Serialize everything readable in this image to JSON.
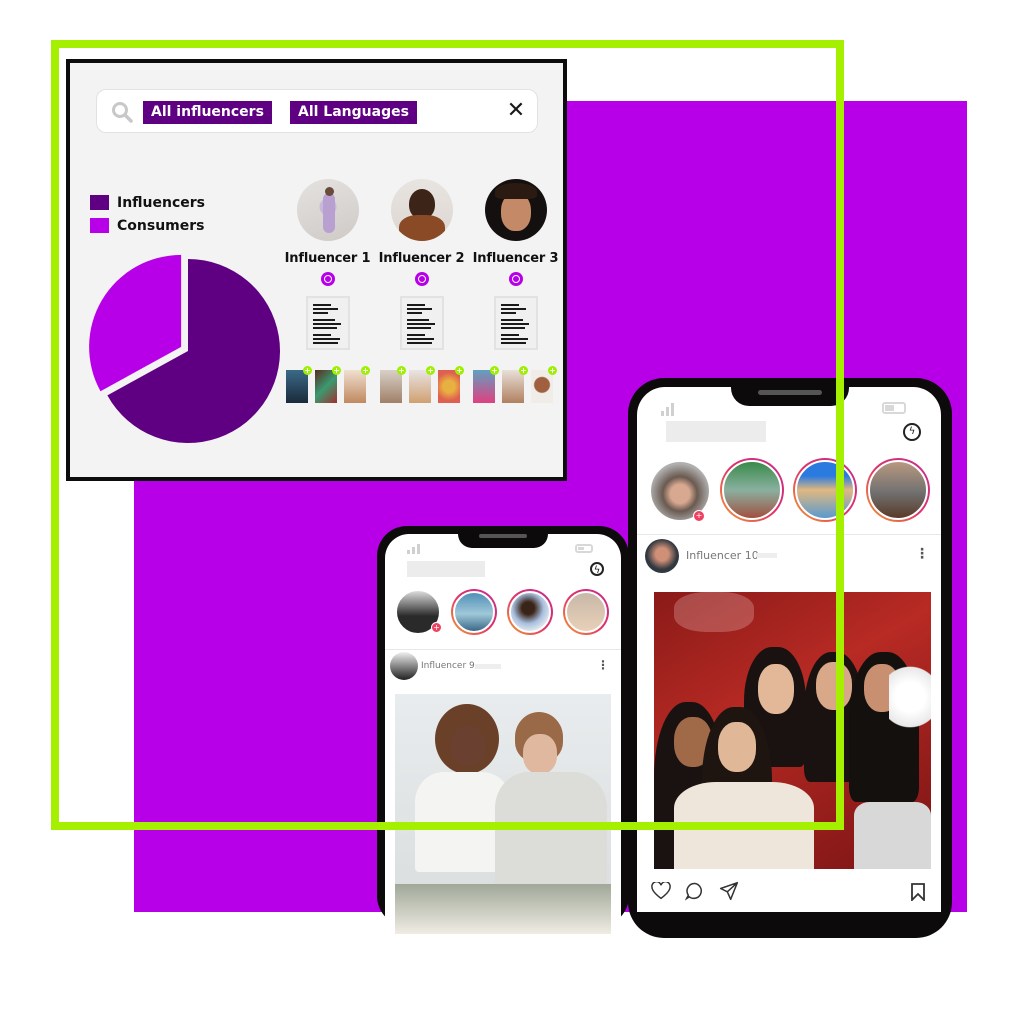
{
  "dashboard": {
    "search": {
      "icon": "search-icon",
      "filters": [
        "All influencers",
        "All Languages"
      ],
      "clear_icon": "close-icon",
      "clear_glyph": "✕"
    },
    "legend": [
      {
        "label": "Influencers",
        "color": "#5f0082"
      },
      {
        "label": "Consumers",
        "color": "#b800e8"
      }
    ],
    "influencers": [
      {
        "name": "Influencer 1",
        "verified": true,
        "media_count": 3
      },
      {
        "name": "Influencer 2",
        "verified": true,
        "media_count": 3
      },
      {
        "name": "Influencer 3",
        "verified": true,
        "media_count": 3
      }
    ],
    "add_glyph": "+"
  },
  "chart_data": {
    "type": "pie",
    "title": "",
    "categories": [
      "Influencers",
      "Consumers"
    ],
    "values": [
      67,
      33
    ],
    "colors": [
      "#5f0082",
      "#b800e8"
    ],
    "exploded": "Consumers",
    "legend_position": "top-left"
  },
  "phone_small": {
    "post_author": "Influencer 9",
    "story_add_glyph": "+",
    "more_glyph": "⋮"
  },
  "phone_large": {
    "post_author": "Influencer 10",
    "story_add_glyph": "+",
    "more_glyph": "⋮",
    "actions": [
      "heart-icon",
      "comment-icon",
      "share-icon",
      "bookmark-icon"
    ]
  },
  "colors": {
    "accent_purple": "#b800e8",
    "dark_purple": "#5f0082",
    "lime_green": "#a4f000"
  }
}
